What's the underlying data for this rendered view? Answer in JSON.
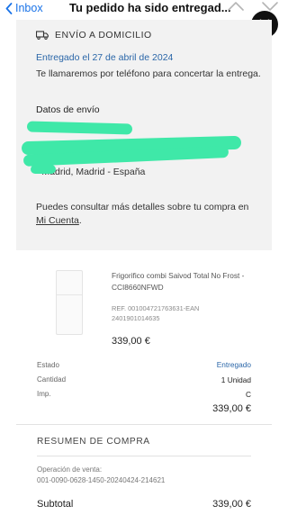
{
  "nav": {
    "back_label": "Inbox",
    "title": "Tu pedido ha sido entregad..."
  },
  "delivery": {
    "heading": "ENVÍO A DOMICILIO",
    "delivered_date": "Entregado el 27 de abril de 2024",
    "phone_notice": "Te llamaremos por teléfono para concertar la entrega.",
    "shipping_data_label": "Datos de envío",
    "address_visible": "- Madrid, Madrid - España",
    "details_prefix": "Puedes consultar más detalles sobre tu compra en ",
    "details_link": "Mi Cuenta",
    "details_suffix": "."
  },
  "product": {
    "name": "Frigorifico combi Saivod Total No Frost - CCI8660NFWD",
    "ref": "REF. 001004721763631-EAN 2401901014635",
    "price": "339,00 €"
  },
  "details": {
    "status_label": "Estado",
    "status_value": "Entregado",
    "quantity_label": "Cantidad",
    "quantity_value": "1 Unidad",
    "tax_label": "Imp.",
    "tax_value": "C",
    "total": "339,00 €"
  },
  "summary": {
    "title": "RESUMEN DE COMPRA",
    "operation_label": "Operación de venta:",
    "operation_code": "001-0090-0628-1450-20240424-214621",
    "subtotal_label": "Subtotal",
    "subtotal_value": "339,00 €"
  },
  "colors": {
    "link_blue": "#1a73e8",
    "status_blue": "#2a66a8",
    "card_bg": "#f2f2f2",
    "redaction_green": "#3fe8a8"
  },
  "icons": [
    "chevron-left-icon",
    "chevron-up-icon",
    "chevron-down-icon",
    "close-icon",
    "truck-icon"
  ]
}
